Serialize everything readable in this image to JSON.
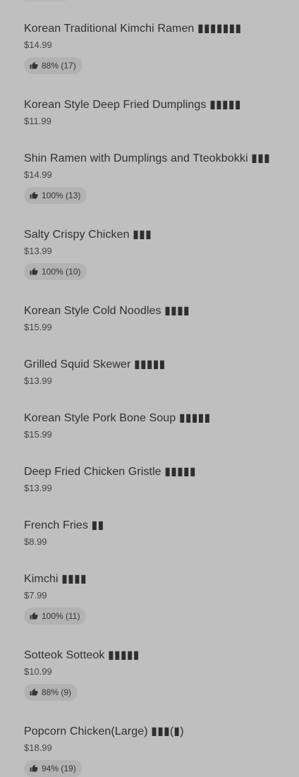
{
  "menu": {
    "items": [
      {
        "name": "Korean Traditional Kimchi Ramen ▮▮▮▮▮▮▮",
        "price": "$14.99",
        "rating": "88% (17)"
      },
      {
        "name": "Korean Style Deep Fried Dumplings ▮▮▮▮▮",
        "price": "$11.99"
      },
      {
        "name": "Shin Ramen with Dumplings and Tteokbokki ▮▮▮",
        "price": "$14.99",
        "rating": "100% (13)"
      },
      {
        "name": "Salty Crispy Chicken ▮▮▮",
        "price": "$13.99",
        "rating": "100% (10)"
      },
      {
        "name": "Korean Style Cold Noodles ▮▮▮▮",
        "price": "$15.99"
      },
      {
        "name": "Grilled Squid Skewer ▮▮▮▮▮",
        "price": "$13.99"
      },
      {
        "name": "Korean Style Pork Bone Soup ▮▮▮▮▮",
        "price": "$15.99"
      },
      {
        "name": "Deep Fried Chicken Gristle ▮▮▮▮▮",
        "price": "$13.99"
      },
      {
        "name": "French Fries ▮▮",
        "price": "$8.99"
      },
      {
        "name": "Kimchi ▮▮▮▮",
        "price": "$7.99",
        "rating": "100% (11)"
      },
      {
        "name": "Sotteok Sotteok ▮▮▮▮▮",
        "price": "$10.99",
        "rating": "88% (9)"
      },
      {
        "name": "Popcorn Chicken(Large) ▮▮▮(▮)",
        "price": "$18.99",
        "rating": "94% (19)"
      }
    ],
    "icon": "thumbs-up-icon"
  }
}
